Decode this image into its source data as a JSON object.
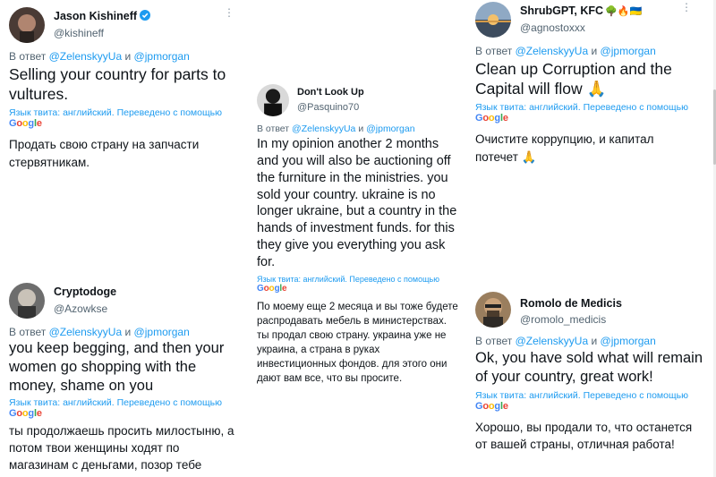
{
  "reply_prefix": "В ответ",
  "reply_and": "и",
  "translate_label": "Язык твита: английский. Переведено с помощью",
  "google_logo": [
    "G",
    "o",
    "o",
    "g",
    "l",
    "e"
  ],
  "google_colors": [
    "#4285F4",
    "#EA4335",
    "#FBBC05",
    "#4285F4",
    "#34A853",
    "#EA4335"
  ],
  "accent_color": "#1d9bf0",
  "tweets": [
    {
      "name": "Jason Kishineff",
      "verified": true,
      "handle": "@kishineff",
      "mention1": "@ZelenskyyUa",
      "mention2": "@jpmorgan",
      "text": "Selling your country for parts to vultures.",
      "translation": "Продать свою страну на запчасти стервятникам."
    },
    {
      "name": "ShrubGPT, KFC",
      "name_emoji": "🌳🔥🇺🇦",
      "handle": "@agnostoxxx",
      "mention1": "@ZelenskyyUa",
      "mention2": "@jpmorgan",
      "text": "Clean up Corruption and the Capital will flow 🙏",
      "translation": "Очистите коррупцию, и капитал потечет 🙏"
    },
    {
      "name": "Don't Look Up",
      "handle": "@Pasquino70",
      "mention1": "@ZelenskyyUa",
      "mention2": "@jpmorgan",
      "text": "In my opinion another 2 months and you will also be auctioning off the furniture in the ministries. you sold your country.  ukraine is no longer ukraine, but a country in the hands of investment funds. for this they give you everything you ask for.",
      "translation": "По моему еще 2 месяца и вы тоже будете распродавать мебель в министерствах. ты продал свою страну. украина уже не украина, а страна в руках инвестиционных фондов. для этого они дают вам все, что вы просите."
    },
    {
      "name": "Cryptodoge",
      "handle": "@Azowkse",
      "mention1": "@ZelenskyyUa",
      "mention2": "@jpmorgan",
      "text": "you keep begging, and then your women go shopping with the money, shame on you",
      "translation": "ты продолжаешь просить милостыню, а потом твои женщины ходят по магазинам с деньгами, позор тебе"
    },
    {
      "name": "Romolo de Medicis",
      "handle": "@romolo_medicis",
      "mention1": "@ZelenskyyUa",
      "mention2": "@jpmorgan",
      "text": "Ok, you have sold what will remain of your country, great work!",
      "translation": "Хорошо, вы продали то, что останется от вашей страны, отличная работа!"
    }
  ]
}
